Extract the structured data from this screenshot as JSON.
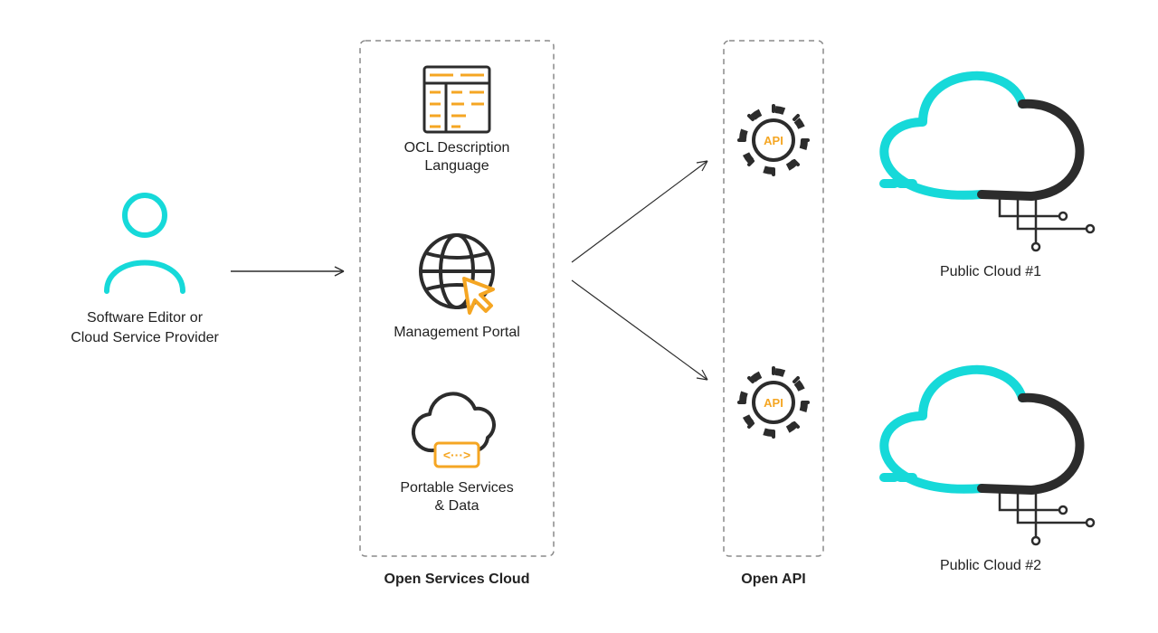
{
  "colors": {
    "teal": "#16d9d9",
    "orange": "#f5a623",
    "dark": "#2c2c2c",
    "grey": "#8a8a8a"
  },
  "actor": {
    "line1": "Software Editor or",
    "line2": "Cloud Service Provider"
  },
  "osc": {
    "title": "Open Services Cloud",
    "items": [
      {
        "line1": "OCL Description",
        "line2": "Language"
      },
      {
        "line1": "Management Portal",
        "line2": ""
      },
      {
        "line1": "Portable Services",
        "line2": "& Data"
      }
    ]
  },
  "openapi": {
    "title": "Open API",
    "badge": "API"
  },
  "clouds": [
    {
      "label": "Public Cloud #1"
    },
    {
      "label": "Public Cloud #2"
    }
  ]
}
